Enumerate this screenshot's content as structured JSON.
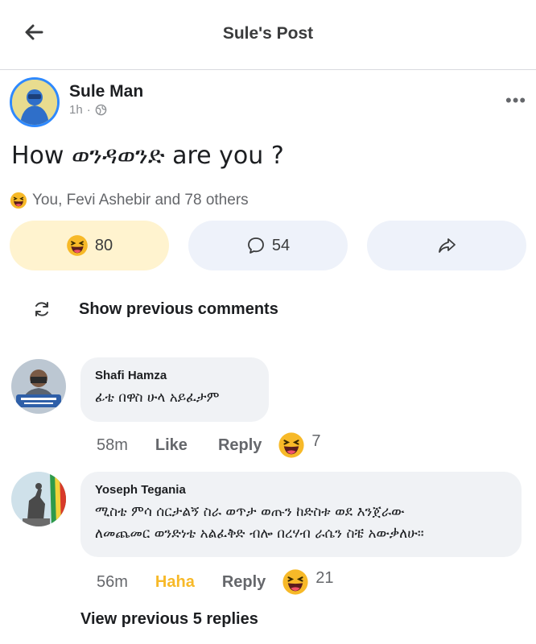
{
  "header": {
    "title": "Sule's Post"
  },
  "post": {
    "author": "Sule Man",
    "time": "1h",
    "separator": "·",
    "text": "How ወንዳወንድ are you ?",
    "reactions_summary": "You, Fevi Ashebir and 78 others",
    "reaction_count": "80",
    "comment_count": "54"
  },
  "show_previous_comments": "Show previous comments",
  "comments": [
    {
      "name": "Shafi Hamza",
      "text": "ፊቴ በዋስ ሁላ አይፈታም",
      "time": "58m",
      "like": "Like",
      "reply": "Reply",
      "reaction_count": "7"
    },
    {
      "name": "Yoseph Tegania",
      "text_line1": "ሚስቴ ምሳ ሰርታልኝ ስራ ወጥታ ወጡን ከድስቱ ወደ እንጀራው",
      "text_line2": "ለመጨመር ወንድነቴ አልፈቅድ ብሎ በረሃብ ራሴን ስቼ አውቃለሁ።",
      "time": "56m",
      "like": "Haha",
      "reply": "Reply",
      "reaction_count": "21"
    }
  ],
  "view_replies": "View previous 5 replies",
  "colors": {
    "haha_yellow": "#f7b928",
    "accent_blue": "#2e89ff",
    "pill_react_bg": "#fff3cf",
    "pill_bg": "#eef2fa"
  },
  "icons": {
    "back": "arrow-left-icon",
    "globe": "globe-icon",
    "more": "more-horizontal-icon",
    "haha": "haha-emoji-icon",
    "comment": "comment-bubble-icon",
    "share": "share-arrow-icon",
    "refresh": "refresh-icon"
  }
}
